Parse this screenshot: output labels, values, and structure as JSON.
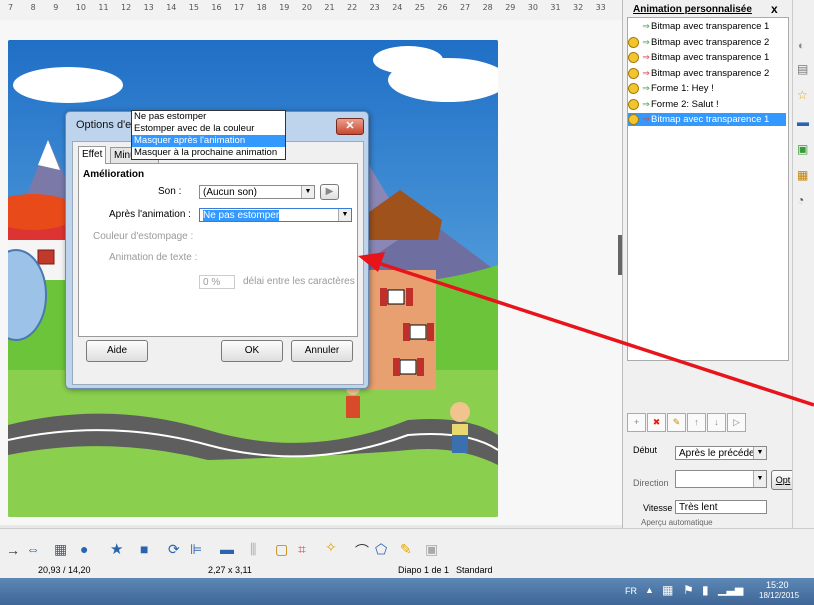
{
  "ruler": {
    "ticks": [
      "7",
      "8",
      "9",
      "10",
      "11",
      "12",
      "13",
      "14",
      "15",
      "16",
      "17",
      "18",
      "19",
      "20",
      "21",
      "22",
      "23",
      "24",
      "25",
      "26",
      "27",
      "28",
      "29",
      "30",
      "31",
      "32",
      "33"
    ]
  },
  "dialog": {
    "title": "Options d'effet",
    "close_label": "✕",
    "tabs": [
      "Effet",
      "Minutage"
    ],
    "section": "Amélioration",
    "son_label": "Son :",
    "son_value": "(Aucun son)",
    "apres_label": "Après l'animation :",
    "apres_value": "Ne pas estomper",
    "couleur_label": "Couleur d'estompage :",
    "anim_texte_label": "Animation de texte :",
    "delay_value": "0 %",
    "delay_label": "délai entre les caractères",
    "dropdown_options": [
      "Ne pas estomper",
      "Estomper avec de la couleur",
      "Masquer après l'animation",
      "Masquer à la prochaine animation"
    ],
    "dropdown_selected_index": 2,
    "aide_label": "Aide",
    "ok_label": "OK",
    "annuler_label": "Annuler"
  },
  "panel": {
    "title": "Animation personnalisée",
    "close": "x",
    "items": [
      {
        "label": "Bitmap avec transparence 1",
        "clock": false,
        "exit": false
      },
      {
        "label": "Bitmap avec transparence 2",
        "clock": true,
        "exit": false
      },
      {
        "label": "Bitmap avec transparence 1",
        "clock": true,
        "exit": true
      },
      {
        "label": "Bitmap avec transparence 2",
        "clock": true,
        "exit": true
      },
      {
        "label": "Forme 1: Hey !",
        "clock": true,
        "exit": false
      },
      {
        "label": "Forme 2: Salut !",
        "clock": true,
        "exit": false
      },
      {
        "label": "Bitmap avec transparence 1",
        "clock": true,
        "exit": true,
        "selected": true
      }
    ],
    "debut_label": "Début",
    "debut_value": "Après le précédent",
    "direction_label": "Direction",
    "vitesse_label": "Vitesse",
    "vitesse_value": "Très lent",
    "opt_label": "Opt",
    "apercu_label": "Aperçu automatique"
  },
  "status": {
    "position": "20,93 / 14,20",
    "size": "2,27 x 3,11",
    "slide": "Diapo 1 de 1",
    "layout": "Standard"
  },
  "taskbar": {
    "lang": "FR",
    "time": "15:20",
    "date": "18/12/2015"
  }
}
